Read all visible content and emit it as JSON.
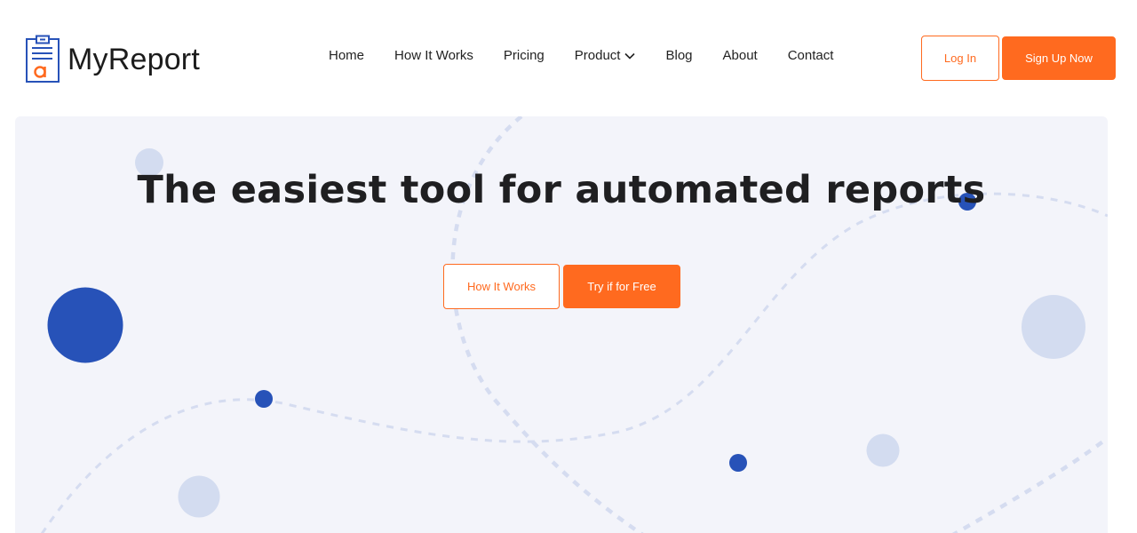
{
  "brand": {
    "name": "MyReport",
    "icon": "clipboard-report-icon",
    "accent": "#ff6a1f",
    "blue": "#2752b8"
  },
  "nav": {
    "items": [
      {
        "label": "Home"
      },
      {
        "label": "How It Works"
      },
      {
        "label": "Pricing"
      },
      {
        "label": "Product",
        "icon": "chevron-down-icon"
      },
      {
        "label": "Blog"
      },
      {
        "label": "About"
      },
      {
        "label": "Contact"
      }
    ]
  },
  "auth": {
    "login_label": "Log In",
    "signup_label": "Sign Up Now"
  },
  "hero": {
    "title": "The easiest tool for automated reports",
    "how_label": "How It Works",
    "try_label": "Try if for Free",
    "background": "#f3f4fa"
  }
}
